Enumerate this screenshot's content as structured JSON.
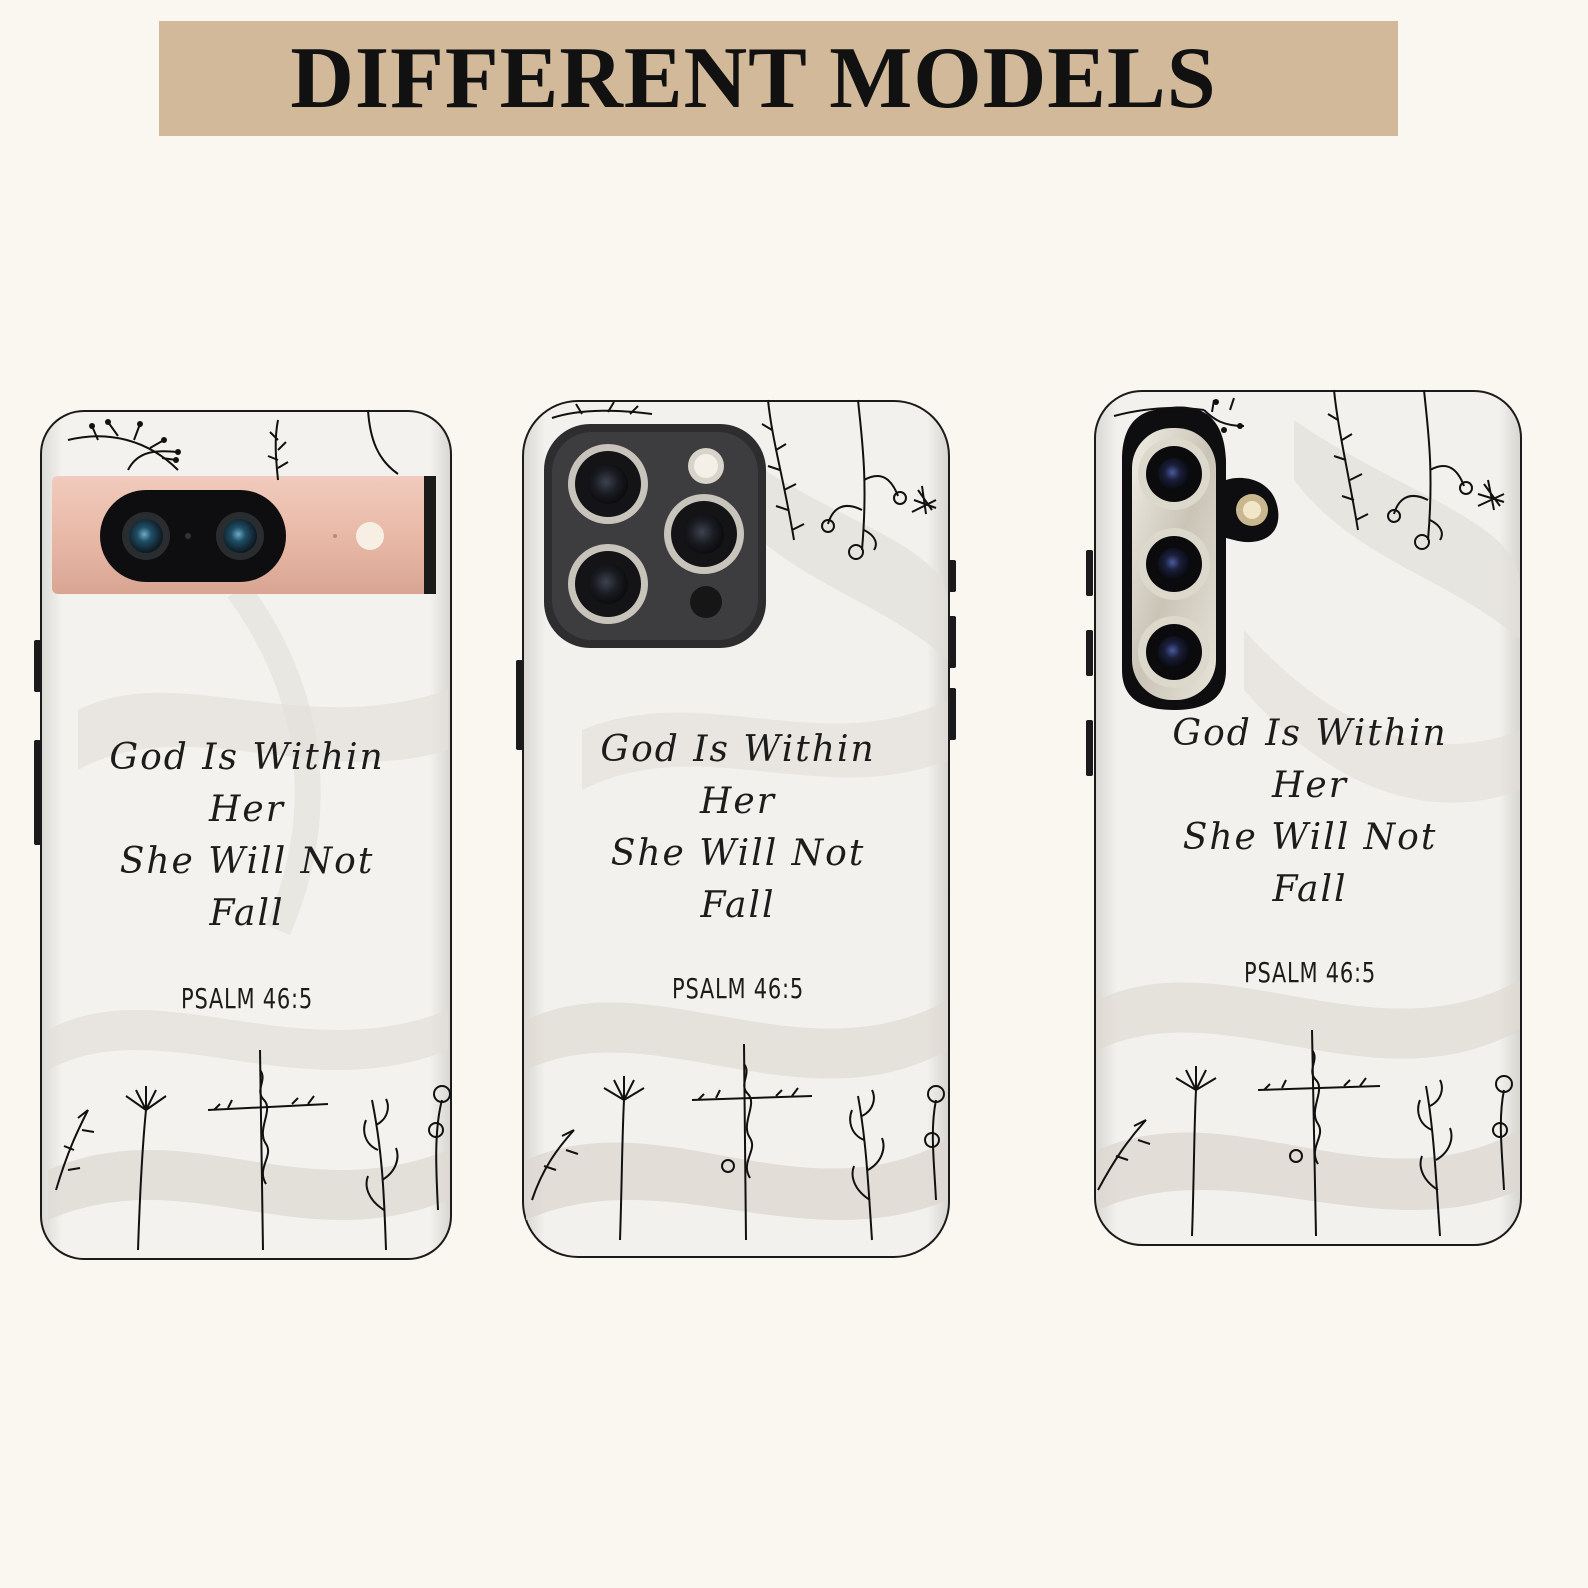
{
  "banner": {
    "title": "DIFFERENT MODELS",
    "background": "#d2b999"
  },
  "background_color": "#faf6f0",
  "phones": [
    {
      "model_icon": "pixel-camera-bar",
      "case_color": "#f2f1ec",
      "accent_color": "#e8bfb0",
      "verse": {
        "line1": "God Is Within",
        "line2": "Her",
        "line3": "She Will Not",
        "line4": "Fall"
      },
      "reference": "PSALM 46:5"
    },
    {
      "model_icon": "iphone-triple-camera",
      "case_color": "#f2f1ec",
      "accent_color": "#3b3b3b",
      "verse": {
        "line1": "God Is Within",
        "line2": "Her",
        "line3": "She Will Not",
        "line4": "Fall"
      },
      "reference": "PSALM 46:5"
    },
    {
      "model_icon": "galaxy-triple-camera",
      "case_color": "#f2f1ec",
      "accent_color": "#111111",
      "verse": {
        "line1": "God Is Within",
        "line2": "Her",
        "line3": "She Will Not",
        "line4": "Fall"
      },
      "reference": "PSALM 46:5"
    }
  ]
}
